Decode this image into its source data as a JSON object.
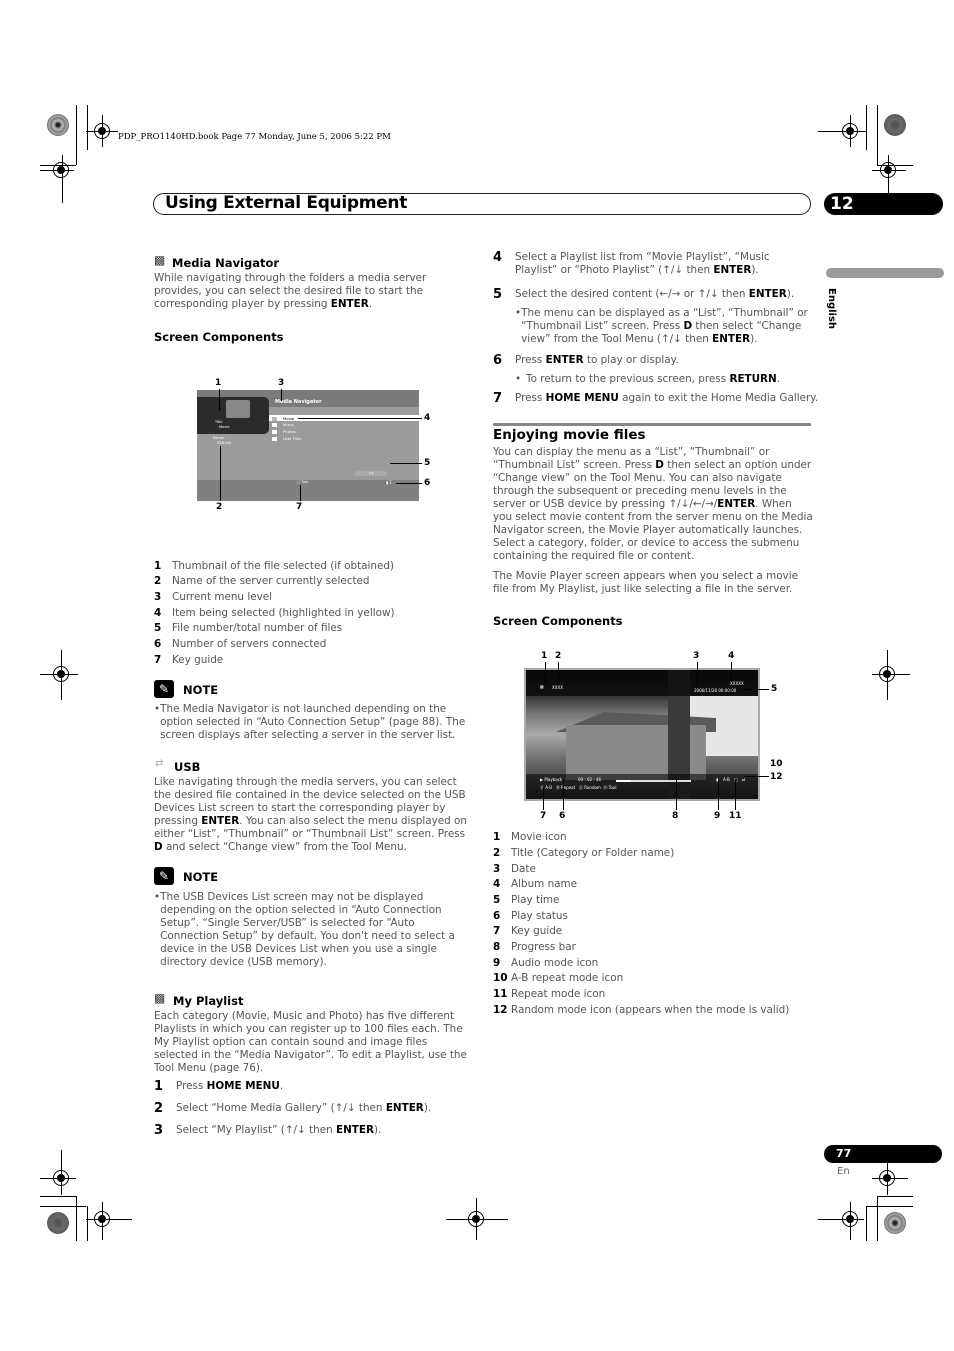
{
  "print_info": "PDP_PRO1140HD.book  Page 77  Monday, June 5, 2006  5:22 PM",
  "header": {
    "title": "Using External Equipment",
    "chapter": "12"
  },
  "side_tab": {
    "language": "English"
  },
  "footer": {
    "page_number": "77",
    "lang_code": "En"
  },
  "left": {
    "media_navigator": {
      "heading": "Media Navigator",
      "body_pre": "While navigating through the folders a media server provides, you can select the desired file to start the corresponding player by pressing ",
      "body_bold": "ENTER",
      "body_post": "."
    },
    "screen_components_heading": "Screen Components",
    "mn_screen": {
      "title": "Media Navigator",
      "thumb_title_label": "Title",
      "thumb_title_value": "Movie",
      "server_label": "Server",
      "server_value": "XXXXXX",
      "list": [
        "Movie",
        "Music",
        "Photos",
        "User Files"
      ],
      "file_count": "1/4",
      "key_guide": "Tool",
      "server_count": "1",
      "callouts": [
        "1",
        "2",
        "3",
        "4",
        "5",
        "6",
        "7"
      ]
    },
    "components": [
      {
        "n": "1",
        "text": "Thumbnail of the file selected (if obtained)"
      },
      {
        "n": "2",
        "text": "Name of the server currently selected"
      },
      {
        "n": "3",
        "text": "Current menu level"
      },
      {
        "n": "4",
        "text": "Item being selected (highlighted in yellow)"
      },
      {
        "n": "5",
        "text": "File number/total number of files"
      },
      {
        "n": "6",
        "text": "Number of servers connected"
      },
      {
        "n": "7",
        "text": "Key guide"
      }
    ],
    "note1": {
      "label": "NOTE",
      "text": "The Media Navigator is not launched depending on the option selected in “Auto Connection Setup” (page 88). The screen displays after selecting a server in the server list."
    },
    "usb": {
      "heading": "USB",
      "p1": "Like navigating through the media servers, you can select the desired file contained in the device selected on the USB Devices List screen to start the corresponding player by pressing ",
      "enter": "ENTER",
      "p2": ". You can also select the menu displayed on either “List”, “Thumbnail” or “Thumbnail List” screen. Press ",
      "d": "D",
      "p3": " and select “Change view” from the Tool Menu."
    },
    "note2": {
      "label": "NOTE",
      "text": "The USB Devices List screen may not be displayed depending on the option selected in “Auto Connection Setup”. “Single Server/USB” is selected for “Auto Connection Setup” by default. You don't need to select a device in the USB Devices List when you use a single directory device (USB memory)."
    },
    "my_playlist": {
      "heading": "My Playlist",
      "body": "Each category (Movie, Music and Photo) has five different Playlists in which you can register up to 100 files each. The My Playlist option can contain sound and image files selected in the “Media Navigator”. To edit a Playlist, use the Tool Menu (page 76)."
    },
    "steps": [
      {
        "n": "1",
        "pre": "Press ",
        "bold": "HOME MENU",
        "post": "."
      },
      {
        "n": "2",
        "pre": "Select “Home Media Gallery” (↑/↓ then ",
        "bold": "ENTER",
        "post": ")."
      },
      {
        "n": "3",
        "pre": "Select “My Playlist” (↑/↓ then ",
        "bold": "ENTER",
        "post": ")."
      }
    ]
  },
  "right": {
    "steps": [
      {
        "n": "4",
        "pre": "Select a Playlist list from “Movie Playlist”, “Music Playlist” or “Photo Playlist” (↑/↓ then ",
        "bold": "ENTER",
        "post": ")."
      },
      {
        "n": "5",
        "pre": "Select the desired content (←/→ or ↑/↓ then ",
        "bold": "ENTER",
        "post": ")."
      },
      {
        "n": "6",
        "pre": "Press ",
        "bold": "ENTER",
        "post": " to play or display."
      },
      {
        "n": "7",
        "pre": "Press ",
        "bold": "HOME MENU",
        "post": " again to exit the Home Media Gallery."
      }
    ],
    "step5_bullet": {
      "pre": "The menu can be displayed as a “List”, “Thumbnail” or “Thumbnail List” screen. Press ",
      "d": "D",
      "mid": " then select “Change view” from the Tool Menu (↑/↓ then ",
      "bold": "ENTER",
      "post": ")."
    },
    "step6_bullet": {
      "pre": "To return to the previous screen, press ",
      "bold": "RETURN",
      "post": "."
    },
    "enjoying": {
      "heading": "Enjoying movie files",
      "p1a": "You can display the menu as a “List”, “Thumbnail” or “Thumbnail List” screen. Press ",
      "p1d": "D",
      "p1b": " then select an option under “Change view” on the Tool Menu. You can also navigate through the subsequent or preceding menu levels in the server or USB device by pressing ↑/↓/←/→/",
      "p1enter": "ENTER",
      "p1c": ". When you select movie content from the server menu on the Media Navigator screen, the Movie Player automatically launches. Select a category, folder, or device to access the submenu containing the required file or content.",
      "p2": "The Movie Player screen appears when you select a movie file from My Playlist, just like selecting a file in the server."
    },
    "screen_components_heading": "Screen Components",
    "mp_screen": {
      "title": "XXXX",
      "album": "XXXXX",
      "date_time": "2006/11/26  00:00:00",
      "status": "Playback",
      "elapsed": "00 : 02 : 46",
      "progress": 0.2,
      "keys": [
        "A-B",
        "Repeat",
        "Random",
        "Tool"
      ],
      "ab_icon": "A-B",
      "callouts": [
        "1",
        "2",
        "3",
        "4",
        "5",
        "6",
        "7",
        "8",
        "9",
        "10",
        "11",
        "12"
      ]
    },
    "components": [
      {
        "n": "1",
        "text": "Movie icon"
      },
      {
        "n": "2",
        "text": "Title (Category or Folder name)"
      },
      {
        "n": "3",
        "text": "Date"
      },
      {
        "n": "4",
        "text": "Album name"
      },
      {
        "n": "5",
        "text": "Play time"
      },
      {
        "n": "6",
        "text": "Play status"
      },
      {
        "n": "7",
        "text": "Key guide"
      },
      {
        "n": "8",
        "text": "Progress bar"
      },
      {
        "n": "9",
        "text": "Audio mode icon"
      },
      {
        "n": "10",
        "text": "A-B repeat mode icon"
      },
      {
        "n": "11",
        "text": "Repeat mode icon"
      },
      {
        "n": "12",
        "text": "Random mode icon (appears when the mode is valid)"
      }
    ]
  }
}
